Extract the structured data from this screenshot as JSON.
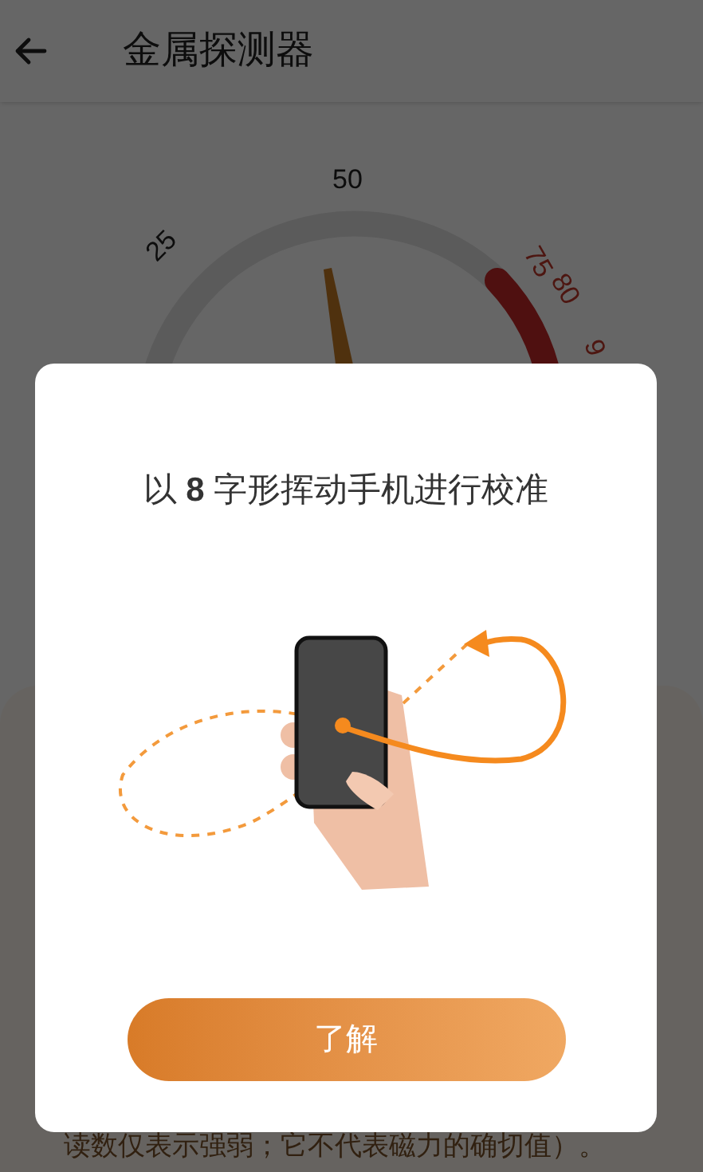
{
  "header": {
    "title": "金属探测器"
  },
  "gauge": {
    "labels": [
      {
        "text": "25",
        "kind": "normal"
      },
      {
        "text": "50",
        "kind": "normal"
      },
      {
        "text": "75",
        "kind": "danger"
      },
      {
        "text": "80",
        "kind": "danger"
      },
      {
        "text": "9",
        "kind": "danger"
      }
    ]
  },
  "info": {
    "text": "读数仅表示强弱；它不代表磁力的确切值）。"
  },
  "dialog": {
    "title": "以 **8** 字形挥动手机进行校准",
    "button": "了解"
  }
}
